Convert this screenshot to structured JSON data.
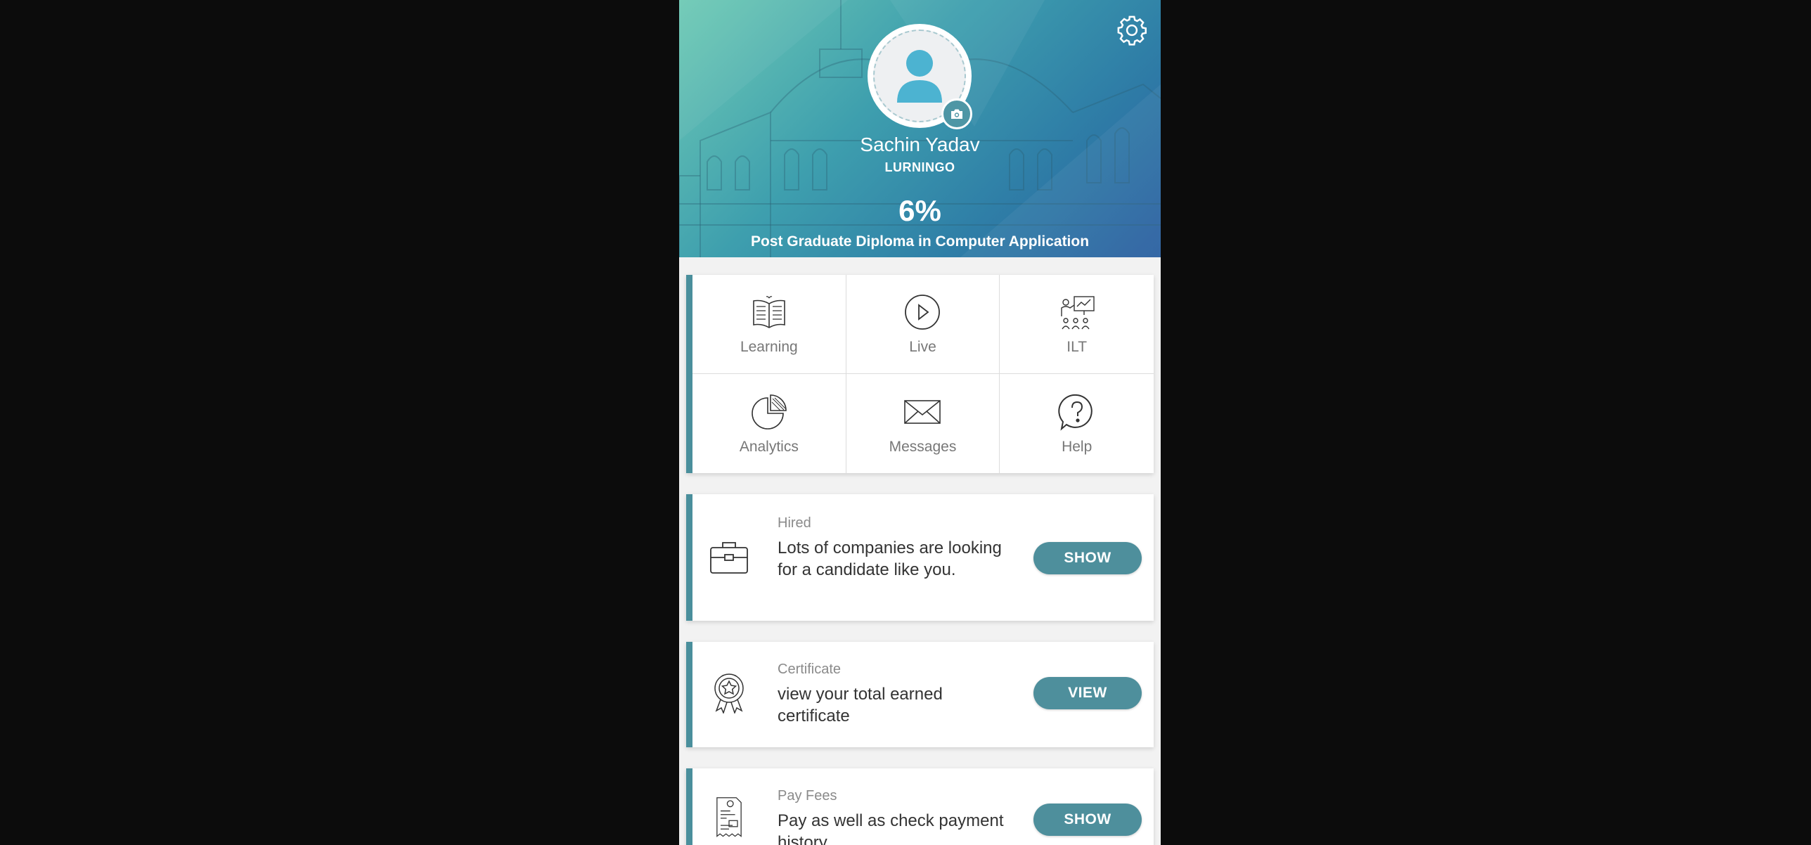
{
  "profile": {
    "name": "Sachin Yadav",
    "organization": "LURNINGO",
    "progress": "6%",
    "progress_value": 0.06,
    "course": "Post Graduate Diploma in Computer Application"
  },
  "menu": [
    {
      "label": "Learning",
      "icon": "book-icon"
    },
    {
      "label": "Live",
      "icon": "play-icon"
    },
    {
      "label": "ILT",
      "icon": "presentation-icon"
    },
    {
      "label": "Analytics",
      "icon": "pie-chart-icon"
    },
    {
      "label": "Messages",
      "icon": "envelope-icon"
    },
    {
      "label": "Help",
      "icon": "help-bubble-icon"
    }
  ],
  "cards": {
    "hired": {
      "category": "Hired",
      "description": "Lots of companies are looking for a candidate like you.",
      "button": "SHOW",
      "icon": "briefcase-icon"
    },
    "certificate": {
      "category": "Certificate",
      "description": "view your total earned certificate",
      "button": "VIEW",
      "icon": "award-icon"
    },
    "fees": {
      "category": "Pay Fees",
      "description": "Pay as well as check payment history",
      "button": "SHOW",
      "icon": "receipt-icon"
    }
  },
  "colors": {
    "accent": "#4e8f9c",
    "hero_start": "#6ecab5",
    "hero_end": "#2b5fa1",
    "avatar": "#4cb3d1"
  }
}
